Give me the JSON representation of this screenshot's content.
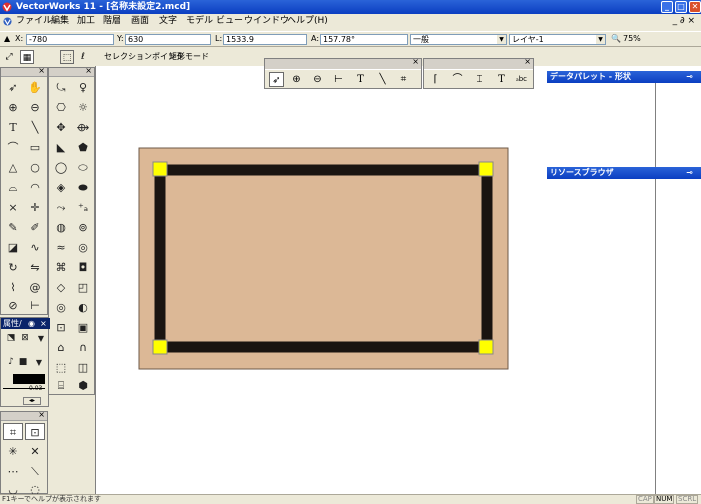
{
  "window": {
    "title": "VectorWorks 11 - [名称未設定2.mcd]",
    "minimize": "_",
    "maximize": "□",
    "close": "✕"
  },
  "menu": {
    "items": [
      "ファイル",
      "編集",
      "加工",
      "階層",
      "画面",
      "文字",
      "モデル",
      "ビュー",
      "ウインドウ",
      "ヘルプ(H)"
    ],
    "doc_controls": "_ ∂ ×"
  },
  "coords": {
    "x_label": "X:",
    "x_value": "-780",
    "y_label": "Y:",
    "y_value": "630",
    "l_label": "L:",
    "l_value": "1533.9",
    "a_label": "A:",
    "a_value": "157.78°",
    "class_value": "一般",
    "layer_value": "レイヤ-1",
    "zoom_value": "75%"
  },
  "modebar": {
    "tool_text": "セレクションポインタ",
    "mode_text": "矩形モード"
  },
  "attributes": {
    "title": "属性/",
    "line_weight": "0.03"
  },
  "docked": {
    "data_palette": "データパレット - 形状",
    "resource_browser": "リソースブラウザ"
  },
  "status": {
    "message": "F1キーでヘルプが表示されます",
    "cap": "CAP",
    "num": "NUM",
    "scrl": "SCRL"
  },
  "colors": {
    "rectangle_fill": "#dcb896",
    "wall_stroke": "#1a1410",
    "handle": "#ffff00",
    "title_blue": "#0b3ec1"
  },
  "icons": {
    "basic_tools": [
      "arrow-icon",
      "hand-icon",
      "zoom-in-icon",
      "zoom-out-icon",
      "text-icon",
      "line-icon",
      "curve-icon",
      "rectangle-icon",
      "polygon-icon",
      "circle-icon",
      "polyline-icon",
      "arc-icon",
      "locus-icon",
      "point-icon",
      "pen-icon",
      "paint-icon",
      "fillet-icon",
      "freehand-icon",
      "rotate-icon",
      "mirror-icon",
      "wave-icon",
      "spiral-icon",
      "slash-circle-icon",
      "dimension-icon"
    ],
    "three_d_tools": [
      "flyover-icon",
      "walkthrough-icon",
      "camera-icon",
      "light-icon",
      "rotate-view-icon",
      "sweep-icon",
      "stair-icon",
      "roof-icon",
      "shape-icon",
      "extrude-icon",
      "solid-icon",
      "mesh-icon",
      "nurbs-icon",
      "loft-icon",
      "pipe-icon",
      "shell-icon",
      "surface-icon",
      "wall-icon",
      "door-icon",
      "window-icon",
      "column-icon",
      "floor-icon",
      "panel-icon",
      "frame-icon"
    ]
  }
}
